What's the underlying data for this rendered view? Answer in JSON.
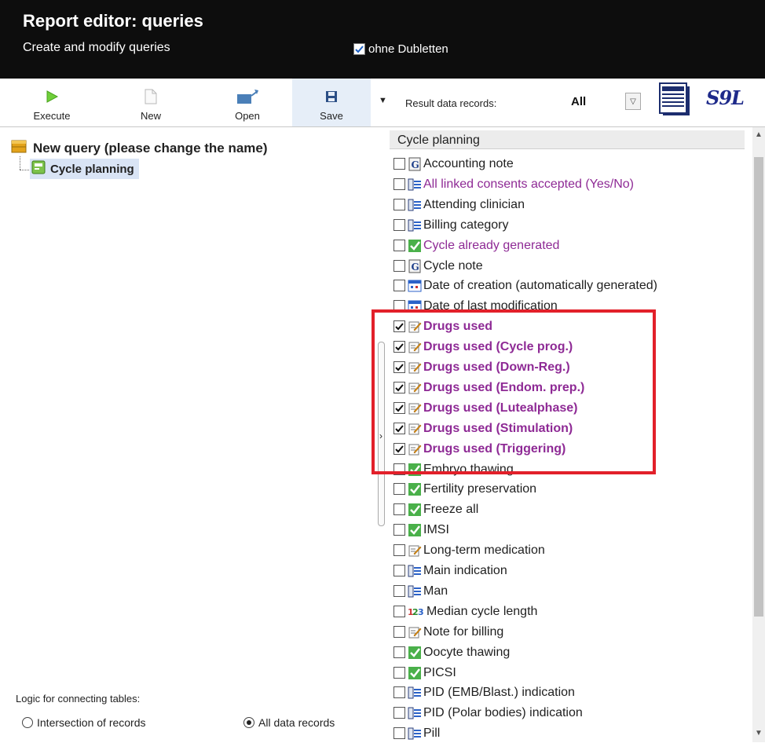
{
  "header": {
    "title": "Report editor: queries",
    "subtitle": "Create and modify queries",
    "dedup_label": "ohne Dubletten",
    "dedup_checked": true
  },
  "toolbar": {
    "execute": "Execute",
    "new": "New",
    "open": "Open",
    "save": "Save",
    "result_label": "Result data records:",
    "result_value": "All",
    "logo_text": "S9L"
  },
  "tree": {
    "root": "New query (please change the name)",
    "child": "Cycle planning"
  },
  "logic": {
    "label": "Logic for connecting tables:",
    "option1": "Intersection of records",
    "option2": "All data records",
    "selected": "option2"
  },
  "fields": {
    "header": "Cycle planning",
    "items": [
      {
        "label": "Accounting note",
        "icon": "memo-icon",
        "checked": false,
        "style": "black"
      },
      {
        "label": "All linked consents accepted (Yes/No)",
        "icon": "list-icon",
        "checked": false,
        "style": "purple"
      },
      {
        "label": "Attending clinician",
        "icon": "list-icon",
        "checked": false,
        "style": "black"
      },
      {
        "label": "Billing category",
        "icon": "list-icon",
        "checked": false,
        "style": "black"
      },
      {
        "label": "Cycle already generated",
        "icon": "check-icon",
        "checked": false,
        "style": "purple"
      },
      {
        "label": "Cycle note",
        "icon": "memo-icon",
        "checked": false,
        "style": "black"
      },
      {
        "label": "Date of creation (automatically generated)",
        "icon": "calendar-icon",
        "checked": false,
        "style": "black"
      },
      {
        "label": "Date of last modification",
        "icon": "calendar-icon",
        "checked": false,
        "style": "black"
      },
      {
        "label": "Drugs used",
        "icon": "edit-icon",
        "checked": true,
        "style": "purple-bold"
      },
      {
        "label": "Drugs used (Cycle prog.)",
        "icon": "edit-icon",
        "checked": true,
        "style": "purple-bold"
      },
      {
        "label": "Drugs used (Down-Reg.)",
        "icon": "edit-icon",
        "checked": true,
        "style": "purple-bold"
      },
      {
        "label": "Drugs used (Endom. prep.)",
        "icon": "edit-icon",
        "checked": true,
        "style": "purple-bold"
      },
      {
        "label": "Drugs used (Lutealphase)",
        "icon": "edit-icon",
        "checked": true,
        "style": "purple-bold"
      },
      {
        "label": "Drugs used (Stimulation)",
        "icon": "edit-icon",
        "checked": true,
        "style": "purple-bold"
      },
      {
        "label": "Drugs used (Triggering)",
        "icon": "edit-icon",
        "checked": true,
        "style": "purple-bold"
      },
      {
        "label": "Embryo thawing",
        "icon": "check-icon",
        "checked": false,
        "style": "black"
      },
      {
        "label": "Fertility preservation",
        "icon": "check-icon",
        "checked": false,
        "style": "black"
      },
      {
        "label": "Freeze all",
        "icon": "check-icon",
        "checked": false,
        "style": "black"
      },
      {
        "label": "IMSI",
        "icon": "check-icon",
        "checked": false,
        "style": "black"
      },
      {
        "label": "Long-term medication",
        "icon": "edit-icon",
        "checked": false,
        "style": "black"
      },
      {
        "label": "Main indication",
        "icon": "list-icon",
        "checked": false,
        "style": "black"
      },
      {
        "label": "Man",
        "icon": "list-icon",
        "checked": false,
        "style": "black"
      },
      {
        "label": "Median cycle length",
        "icon": "number-icon",
        "checked": false,
        "style": "black"
      },
      {
        "label": "Note for billing",
        "icon": "edit-icon",
        "checked": false,
        "style": "black"
      },
      {
        "label": "Oocyte thawing",
        "icon": "check-icon",
        "checked": false,
        "style": "black"
      },
      {
        "label": "PICSI",
        "icon": "check-icon",
        "checked": false,
        "style": "black"
      },
      {
        "label": "PID (EMB/Blast.) indication",
        "icon": "list-icon",
        "checked": false,
        "style": "black"
      },
      {
        "label": "PID (Polar bodies) indication",
        "icon": "list-icon",
        "checked": false,
        "style": "black"
      },
      {
        "label": "Pill",
        "icon": "list-icon",
        "checked": false,
        "style": "black"
      }
    ]
  },
  "colors": {
    "header_bg": "#0d0d0d",
    "purple_text": "#8e2a95",
    "highlight": "#e2202a",
    "selection": "#d9e4f5"
  }
}
